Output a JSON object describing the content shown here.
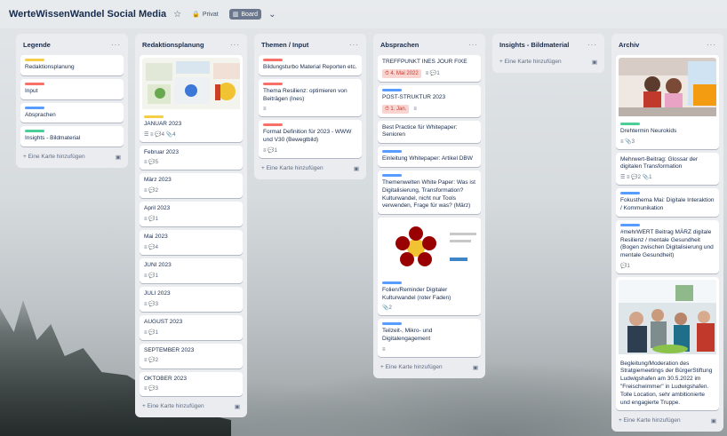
{
  "board": {
    "title": "WerteWissenWandel Social Media",
    "star_icon": "star-icon",
    "visibility": "Privat",
    "view": "Board"
  },
  "colors": {
    "yellow": "#f5cd47",
    "red": "#f87168",
    "blue": "#579dff",
    "green": "#4bce97"
  },
  "add_card_label": "+ Eine Karte hinzufügen",
  "lists": [
    {
      "title": "Legende",
      "cards": [
        {
          "label_color": "yellow",
          "text": "Redaktionsplanung"
        },
        {
          "label_color": "red",
          "text": "Input"
        },
        {
          "label_color": "blue",
          "text": "Absprachen"
        },
        {
          "label_color": "green",
          "text": "Insights - Bildmaterial"
        }
      ]
    },
    {
      "title": "Redaktionsplanung",
      "cards": [
        {
          "label_color": "yellow",
          "text": "JANUAR 2023",
          "badges": "☰ ≡ 💬4  📎4"
        },
        {
          "text": "Februar 2023",
          "badges": "≡  💬5"
        },
        {
          "text": "März 2023",
          "badges": "≡  💬2"
        },
        {
          "text": "April 2023",
          "badges": "≡  💬1"
        },
        {
          "text": "Mai 2023",
          "badges": "≡  💬4"
        },
        {
          "text": "JUNI 2023",
          "badges": "≡  💬1"
        },
        {
          "text": "JULI 2023",
          "badges": "≡  💬3"
        },
        {
          "text": "AUGUST 2023",
          "badges": "≡  💬1"
        },
        {
          "text": "SEPTEMBER 2023",
          "badges": "≡  💬2"
        },
        {
          "text": "OKTOBER 2023",
          "badges": "≡  💬3"
        }
      ]
    },
    {
      "title": "Themen / Input",
      "cards": [
        {
          "label_color": "red",
          "text": "Bildungsturbo Material Reporten etc."
        },
        {
          "label_color": "red",
          "text": "Thema Resilienz: optimieren von Beiträgen (Ines)",
          "badges": "≡"
        },
        {
          "label_color": "red",
          "text": "Format Definition für 2023 - WWW und V30 (Bewegtbild)",
          "badges": "≡  💬1"
        }
      ]
    },
    {
      "title": "Absprachen",
      "cards": [
        {
          "text": "TREFFPUNKT INES JOUR FIXE",
          "date": "4. Mai 2022",
          "badges": "≡  💬1"
        },
        {
          "label_color": "blue",
          "text": "POST-STRUKTUR 2023",
          "date": "1. Jan.",
          "badges": "≡"
        },
        {
          "text": "Best Practice für Whitepaper: Senioren"
        },
        {
          "label_color": "blue",
          "text": "Einleitung Whitepaper: Artikel DBW"
        },
        {
          "label_color": "blue",
          "text": "Themenwelten White Paper: Was ist Digitalisierung, Transformation? Kulturwandel, nicht nur Tools verwenden, Frage für was? (März)"
        },
        {
          "label_color": "blue",
          "text": "Folien/Reminder Digitaler Kulturwandel (roter Faden)",
          "badges": "📎2"
        },
        {
          "label_color": "blue",
          "text": "Teilzeit-, Mikro- und Digitalengagement",
          "badges": "≡"
        }
      ]
    },
    {
      "title": "Insights - Bildmaterial",
      "cards": []
    },
    {
      "title": "Archiv",
      "cards": [
        {
          "label_color": "green",
          "text": "Drehtermin Neurokids",
          "badges": "≡  📎3"
        },
        {
          "text": "Mehrwert-Beitrag: Glossar der digitalen Transformation",
          "badges": "☰ ≡ 💬2  📎1"
        },
        {
          "label_color": "blue",
          "text": "Fokusthema Mai: Digitale Interaktion / Kommunikation"
        },
        {
          "label_color": "blue",
          "text": "#mehrWERT Beitrag MÄRZ digitale Resilienz / mentale Gesundheit (Bogen zwischen Digitalisierung und mentale Gesundheit)",
          "badges": "💬1"
        },
        {
          "text": "Begleitung/Moderation des Stratgiemeetings der BürgerStiftung Ludwigshafen am 30.5.2022 im \"Freischwimmer\" in Ludwigshafen. Tolle Location, sehr ambitionierte und engagierte Truppe."
        }
      ]
    }
  ]
}
